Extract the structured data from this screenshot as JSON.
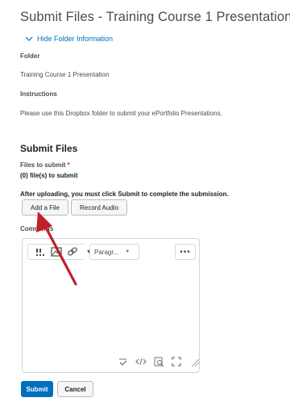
{
  "page": {
    "title": "Submit Files - Training Course 1 Presentation",
    "toggle_label": "Hide Folder Information"
  },
  "folder": {
    "label": "Folder",
    "value": "Training Course 1 Presentation"
  },
  "instructions": {
    "label": "Instructions",
    "value": "Please use this Dropbox folder to submit your ePortfolio Presentations."
  },
  "submit_section": {
    "title": "Submit Files",
    "files_label": "Files to submit",
    "required_marker": "*",
    "files_count": "(0) file(s) to submit",
    "note": "After uploading, you must click Submit to complete the submission.",
    "add_file_label": "Add a File",
    "record_audio_label": "Record Audio",
    "comments_label": "Comments"
  },
  "editor": {
    "paragraph_label": "Paragr...",
    "more_label": "•••"
  },
  "actions": {
    "submit_label": "Submit",
    "cancel_label": "Cancel"
  },
  "colors": {
    "primary": "#006fbf",
    "annotation_arrow": "#c0202a",
    "required": "#cd2026"
  }
}
